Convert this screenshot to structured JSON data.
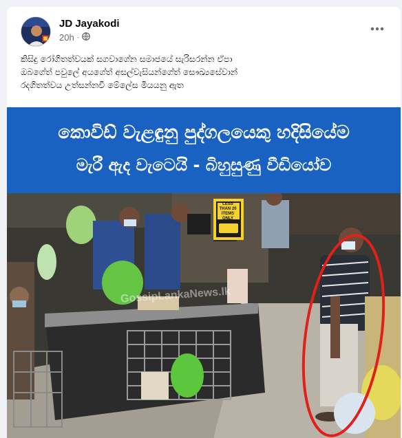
{
  "post": {
    "author": "JD Jayakodi",
    "time": "20h",
    "privacy_icon": "globe-icon",
    "more_icon": "more-dots-icon",
    "text_lines": [
      "කිසිදු රෝගිතත්වයක් සගවාගේන සමාජයේ සැරිසරන්න ඒපා",
      "ඔබගේත් පවුලේ අයගේත් අසල්වැසියන්ගේත් සෞඛ්‍යසේවාන්",
      "රදගිතත්වය උත්සන්නවී මේලේස මියයනු ඇත"
    ]
  },
  "image": {
    "headline_line1": "කොවිඩ් වැළඳුනු පුද්ගලයෙකු හදිසියේම",
    "headline_line2": "මැරී ඇද වැටෙයි - බිහුසුණු වීඩියෝව",
    "sign_text": "LESS THAN 20 ITEMS ONLY",
    "watermark": "GossipLankaNews.lk",
    "banner_color": "#1a62c2",
    "circle_color": "#e0201b"
  }
}
